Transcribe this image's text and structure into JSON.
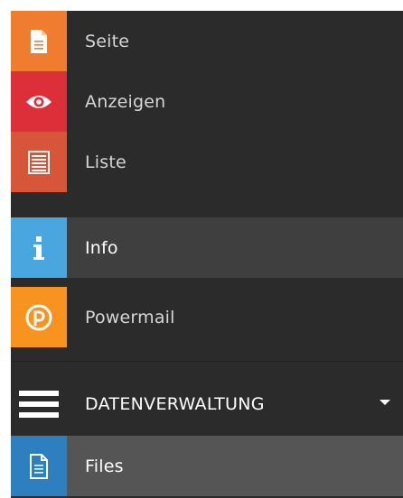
{
  "menu": {
    "items": [
      {
        "label": "Seite",
        "icon": "page-icon",
        "color": "#f07d2f"
      },
      {
        "label": "Anzeigen",
        "icon": "eye-icon",
        "color": "#dc2f3a"
      },
      {
        "label": "Liste",
        "icon": "list-icon",
        "color": "#d7563a"
      },
      {
        "label": "Info",
        "icon": "info-icon",
        "color": "#4aa6df",
        "active": true
      },
      {
        "label": "Powermail",
        "icon": "powermail-icon",
        "color": "#f7931e"
      }
    ],
    "group": {
      "label": "DATENVERWALTUNG",
      "icon": "hamburger-icon",
      "caret_icon": "caret-down-icon",
      "items": [
        {
          "label": "Files",
          "icon": "file-icon",
          "color": "#2e7fc0",
          "active": true
        }
      ]
    }
  },
  "colors": {
    "panel_bg": "#2b2b2b",
    "active_bg": "#3f3f3f",
    "files_active_bg": "#555555"
  }
}
